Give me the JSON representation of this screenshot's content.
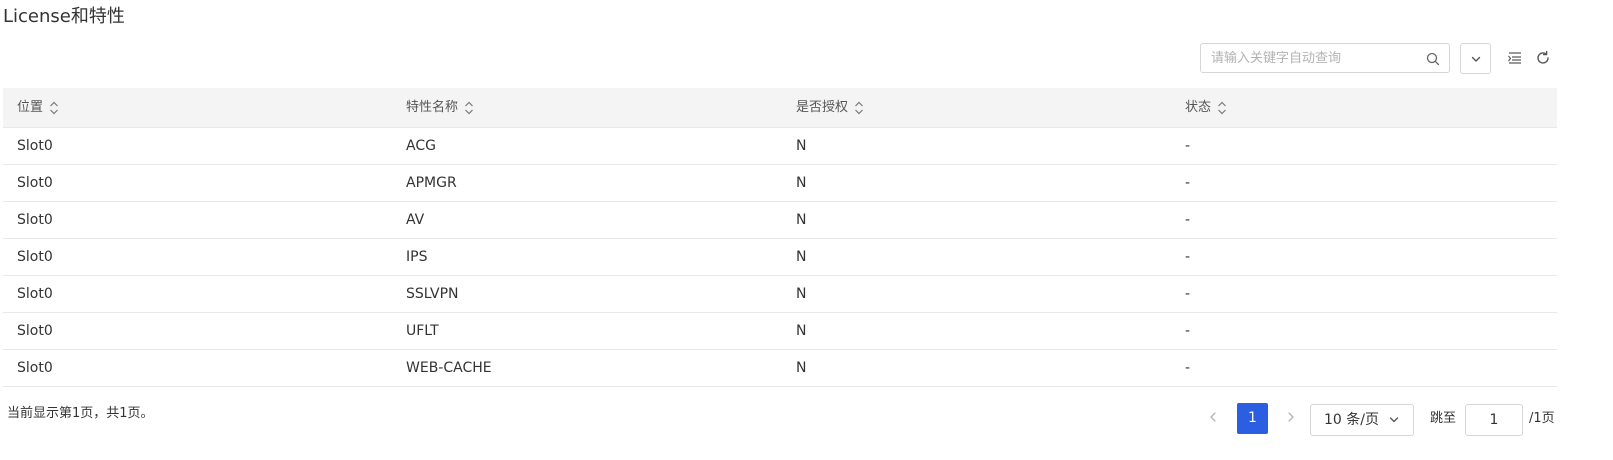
{
  "title": "License和特性",
  "toolbar": {
    "search_placeholder": "请输入关键字自动查询",
    "search_value": ""
  },
  "table": {
    "columns": [
      "位置",
      "特性名称",
      "是否授权",
      "状态"
    ],
    "rows": [
      [
        "Slot0",
        "ACG",
        "N",
        "-"
      ],
      [
        "Slot0",
        "APMGR",
        "N",
        "-"
      ],
      [
        "Slot0",
        "AV",
        "N",
        "-"
      ],
      [
        "Slot0",
        "IPS",
        "N",
        "-"
      ],
      [
        "Slot0",
        "SSLVPN",
        "N",
        "-"
      ],
      [
        "Slot0",
        "UFLT",
        "N",
        "-"
      ],
      [
        "Slot0",
        "WEB-CACHE",
        "N",
        "-"
      ]
    ]
  },
  "footer": {
    "info": "当前显示第1页，共1页。",
    "current_page": "1",
    "page_size": "10 条/页",
    "jump_label": "跳至",
    "jump_value": "1",
    "total_pages": "/1页"
  },
  "colors": {
    "accent": "#2b5ee0",
    "header_bg": "#f4f4f4",
    "border": "#e8e8e8"
  },
  "icons": [
    "search-icon",
    "chevron-down-icon",
    "column-settings-icon",
    "refresh-icon",
    "sort-icon",
    "chevron-left-icon",
    "chevron-right-icon"
  ]
}
